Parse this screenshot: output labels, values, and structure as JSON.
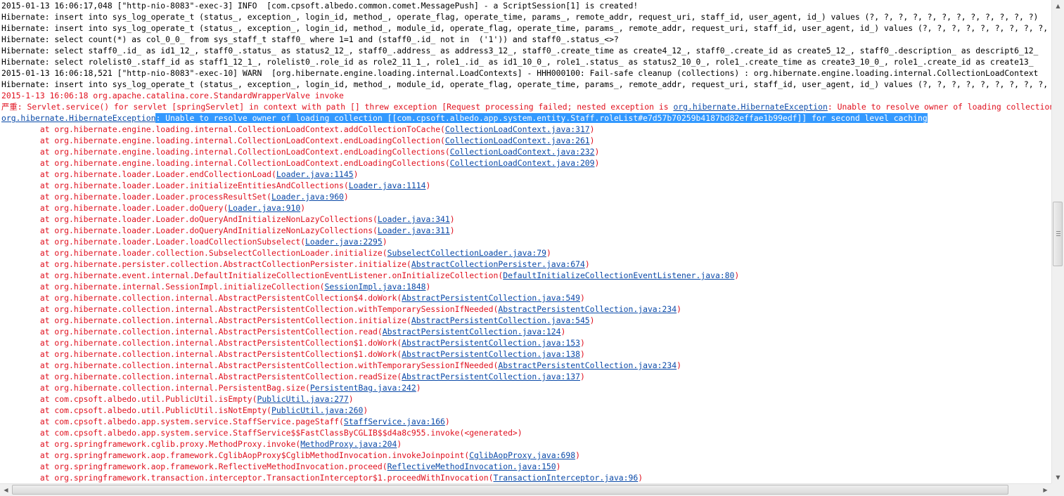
{
  "console": {
    "lines": [
      {
        "kind": "info",
        "parts": [
          {
            "t": "2015-01-13 16:06:17,048 [\"http-nio-8083\"-exec-3] INFO  [com.cpsoft.albedo.common.comet.MessagePush] - a ScriptSession[1] is created!"
          }
        ]
      },
      {
        "kind": "info",
        "parts": [
          {
            "t": "Hibernate: insert into sys_log_operate_t (status_, exception_, login_id, method_, operate_flag, operate_time, params_, remote_addr, request_uri, staff_id, user_agent, id_) values (?, ?, ?, ?, ?, ?, ?, ?, ?, ?, ?, ?)"
          }
        ]
      },
      {
        "kind": "info",
        "parts": [
          {
            "t": "Hibernate: insert into sys_log_operate_t (status_, exception_, login_id, method_, module_id, operate_flag, operate_time, params_, remote_addr, request_uri, staff_id, user_agent, id_) values (?, ?, ?, ?, ?, ?, ?, ?, ?, ?, ?, ?, ?)"
          }
        ]
      },
      {
        "kind": "info",
        "parts": [
          {
            "t": "Hibernate: select count(*) as col_0_0_ from sys_staff_t staff0_ where 1=1 and (staff0_.id_ not in  ('1')) and staff0_.status_<>?"
          }
        ]
      },
      {
        "kind": "info",
        "parts": [
          {
            "t": "Hibernate: select staff0_.id_ as id1_12_, staff0_.status_ as status2_12_, staff0_.address_ as address3_12_, staff0_.create_time as create4_12_, staff0_.create_id as create5_12_, staff0_.description_ as descript6_12_"
          }
        ]
      },
      {
        "kind": "info",
        "parts": [
          {
            "t": "Hibernate: select rolelist0_.staff_id as staff1_12_1_, rolelist0_.role_id as role2_11_1_, role1_.id_ as id1_10_0_, role1_.status_ as status2_10_0_, role1_.create_time as create3_10_0_, role1_.create_id as create13_"
          }
        ]
      },
      {
        "kind": "info",
        "parts": [
          {
            "t": "2015-01-13 16:06:18,521 [\"http-nio-8083\"-exec-10] WARN  [org.hibernate.engine.loading.internal.LoadContexts] - HHH000100: Fail-safe cleanup (collections) : org.hibernate.engine.loading.internal.CollectionLoadContext"
          }
        ]
      },
      {
        "kind": "info",
        "parts": [
          {
            "t": "Hibernate: insert into sys_log_operate_t (status_, exception_, login_id, method_, module_id, operate_flag, operate_time, params_, remote_addr, request_uri, staff_id, user_agent, id_) values (?, ?, ?, ?, ?, ?, ?, ?, ?, ?, ?, ?, ?)"
          }
        ]
      },
      {
        "kind": "err",
        "parts": [
          {
            "t": "2015-1-13 16:06:18 org.apache.catalina.core.StandardWrapperValve invoke"
          }
        ]
      },
      {
        "kind": "err",
        "parts": [
          {
            "t": "严重: Servlet.service() for servlet [springServlet] in context with path [] threw exception [Request processing failed; nested exception is "
          },
          {
            "t": "org.hibernate.HibernateException",
            "link": true
          },
          {
            "t": ": Unable to resolve owner of loading collection"
          }
        ]
      },
      {
        "kind": "err",
        "parts": [
          {
            "t": "org.hibernate.HibernateException",
            "link": true
          },
          {
            "t": ": Unable to resolve owner of loading collection [[com.cpsoft.albedo.app.system.entity.Staff.roleList#e7d57b70259b4187bd82effae1b99edf]] for second level caching",
            "sel": true
          }
        ]
      },
      {
        "kind": "trace",
        "parts": [
          {
            "t": "\tat org.hibernate.engine.loading.internal.CollectionLoadContext.addCollectionToCache("
          },
          {
            "t": "CollectionLoadContext.java:317",
            "link": true
          },
          {
            "t": ")"
          }
        ]
      },
      {
        "kind": "trace",
        "parts": [
          {
            "t": "\tat org.hibernate.engine.loading.internal.CollectionLoadContext.endLoadingCollection("
          },
          {
            "t": "CollectionLoadContext.java:261",
            "link": true
          },
          {
            "t": ")"
          }
        ]
      },
      {
        "kind": "trace",
        "parts": [
          {
            "t": "\tat org.hibernate.engine.loading.internal.CollectionLoadContext.endLoadingCollections("
          },
          {
            "t": "CollectionLoadContext.java:232",
            "link": true
          },
          {
            "t": ")"
          }
        ]
      },
      {
        "kind": "trace",
        "parts": [
          {
            "t": "\tat org.hibernate.engine.loading.internal.CollectionLoadContext.endLoadingCollections("
          },
          {
            "t": "CollectionLoadContext.java:209",
            "link": true
          },
          {
            "t": ")"
          }
        ]
      },
      {
        "kind": "trace",
        "parts": [
          {
            "t": "\tat org.hibernate.loader.Loader.endCollectionLoad("
          },
          {
            "t": "Loader.java:1145",
            "link": true
          },
          {
            "t": ")"
          }
        ]
      },
      {
        "kind": "trace",
        "parts": [
          {
            "t": "\tat org.hibernate.loader.Loader.initializeEntitiesAndCollections("
          },
          {
            "t": "Loader.java:1114",
            "link": true
          },
          {
            "t": ")"
          }
        ]
      },
      {
        "kind": "trace",
        "parts": [
          {
            "t": "\tat org.hibernate.loader.Loader.processResultSet("
          },
          {
            "t": "Loader.java:960",
            "link": true
          },
          {
            "t": ")"
          }
        ]
      },
      {
        "kind": "trace",
        "parts": [
          {
            "t": "\tat org.hibernate.loader.Loader.doQuery("
          },
          {
            "t": "Loader.java:910",
            "link": true
          },
          {
            "t": ")"
          }
        ]
      },
      {
        "kind": "trace",
        "parts": [
          {
            "t": "\tat org.hibernate.loader.Loader.doQueryAndInitializeNonLazyCollections("
          },
          {
            "t": "Loader.java:341",
            "link": true
          },
          {
            "t": ")"
          }
        ]
      },
      {
        "kind": "trace",
        "parts": [
          {
            "t": "\tat org.hibernate.loader.Loader.doQueryAndInitializeNonLazyCollections("
          },
          {
            "t": "Loader.java:311",
            "link": true
          },
          {
            "t": ")"
          }
        ]
      },
      {
        "kind": "trace",
        "parts": [
          {
            "t": "\tat org.hibernate.loader.Loader.loadCollectionSubselect("
          },
          {
            "t": "Loader.java:2295",
            "link": true
          },
          {
            "t": ")"
          }
        ]
      },
      {
        "kind": "trace",
        "parts": [
          {
            "t": "\tat org.hibernate.loader.collection.SubselectCollectionLoader.initialize("
          },
          {
            "t": "SubselectCollectionLoader.java:79",
            "link": true
          },
          {
            "t": ")"
          }
        ]
      },
      {
        "kind": "trace",
        "parts": [
          {
            "t": "\tat org.hibernate.persister.collection.AbstractCollectionPersister.initialize("
          },
          {
            "t": "AbstractCollectionPersister.java:674",
            "link": true
          },
          {
            "t": ")"
          }
        ]
      },
      {
        "kind": "trace",
        "parts": [
          {
            "t": "\tat org.hibernate.event.internal.DefaultInitializeCollectionEventListener.onInitializeCollection("
          },
          {
            "t": "DefaultInitializeCollectionEventListener.java:80",
            "link": true
          },
          {
            "t": ")"
          }
        ]
      },
      {
        "kind": "trace",
        "parts": [
          {
            "t": "\tat org.hibernate.internal.SessionImpl.initializeCollection("
          },
          {
            "t": "SessionImpl.java:1848",
            "link": true
          },
          {
            "t": ")"
          }
        ]
      },
      {
        "kind": "trace",
        "parts": [
          {
            "t": "\tat org.hibernate.collection.internal.AbstractPersistentCollection$4.doWork("
          },
          {
            "t": "AbstractPersistentCollection.java:549",
            "link": true
          },
          {
            "t": ")"
          }
        ]
      },
      {
        "kind": "trace",
        "parts": [
          {
            "t": "\tat org.hibernate.collection.internal.AbstractPersistentCollection.withTemporarySessionIfNeeded("
          },
          {
            "t": "AbstractPersistentCollection.java:234",
            "link": true
          },
          {
            "t": ")"
          }
        ]
      },
      {
        "kind": "trace",
        "parts": [
          {
            "t": "\tat org.hibernate.collection.internal.AbstractPersistentCollection.initialize("
          },
          {
            "t": "AbstractPersistentCollection.java:545",
            "link": true
          },
          {
            "t": ")"
          }
        ]
      },
      {
        "kind": "trace",
        "parts": [
          {
            "t": "\tat org.hibernate.collection.internal.AbstractPersistentCollection.read("
          },
          {
            "t": "AbstractPersistentCollection.java:124",
            "link": true
          },
          {
            "t": ")"
          }
        ]
      },
      {
        "kind": "trace",
        "parts": [
          {
            "t": "\tat org.hibernate.collection.internal.AbstractPersistentCollection$1.doWork("
          },
          {
            "t": "AbstractPersistentCollection.java:153",
            "link": true
          },
          {
            "t": ")"
          }
        ]
      },
      {
        "kind": "trace",
        "parts": [
          {
            "t": "\tat org.hibernate.collection.internal.AbstractPersistentCollection$1.doWork("
          },
          {
            "t": "AbstractPersistentCollection.java:138",
            "link": true
          },
          {
            "t": ")"
          }
        ]
      },
      {
        "kind": "trace",
        "parts": [
          {
            "t": "\tat org.hibernate.collection.internal.AbstractPersistentCollection.withTemporarySessionIfNeeded("
          },
          {
            "t": "AbstractPersistentCollection.java:234",
            "link": true
          },
          {
            "t": ")"
          }
        ]
      },
      {
        "kind": "trace",
        "parts": [
          {
            "t": "\tat org.hibernate.collection.internal.AbstractPersistentCollection.readSize("
          },
          {
            "t": "AbstractPersistentCollection.java:137",
            "link": true
          },
          {
            "t": ")"
          }
        ]
      },
      {
        "kind": "trace",
        "parts": [
          {
            "t": "\tat org.hibernate.collection.internal.PersistentBag.size("
          },
          {
            "t": "PersistentBag.java:242",
            "link": true
          },
          {
            "t": ")"
          }
        ]
      },
      {
        "kind": "trace",
        "parts": [
          {
            "t": "\tat com.cpsoft.albedo.util.PublicUtil.isEmpty("
          },
          {
            "t": "PublicUtil.java:277",
            "link": true
          },
          {
            "t": ")"
          }
        ]
      },
      {
        "kind": "trace",
        "parts": [
          {
            "t": "\tat com.cpsoft.albedo.util.PublicUtil.isNotEmpty("
          },
          {
            "t": "PublicUtil.java:260",
            "link": true
          },
          {
            "t": ")"
          }
        ]
      },
      {
        "kind": "trace",
        "parts": [
          {
            "t": "\tat com.cpsoft.albedo.app.system.service.StaffService.pageStaff("
          },
          {
            "t": "StaffService.java:166",
            "link": true
          },
          {
            "t": ")"
          }
        ]
      },
      {
        "kind": "trace",
        "parts": [
          {
            "t": "\tat com.cpsoft.albedo.app.system.service.StaffService$$FastClassByCGLIB$$d4a8c955.invoke(<generated>)"
          }
        ]
      },
      {
        "kind": "trace",
        "parts": [
          {
            "t": "\tat org.springframework.cglib.proxy.MethodProxy.invoke("
          },
          {
            "t": "MethodProxy.java:204",
            "link": true
          },
          {
            "t": ")"
          }
        ]
      },
      {
        "kind": "trace",
        "parts": [
          {
            "t": "\tat org.springframework.aop.framework.CglibAopProxy$CglibMethodInvocation.invokeJoinpoint("
          },
          {
            "t": "CglibAopProxy.java:698",
            "link": true
          },
          {
            "t": ")"
          }
        ]
      },
      {
        "kind": "trace",
        "parts": [
          {
            "t": "\tat org.springframework.aop.framework.ReflectiveMethodInvocation.proceed("
          },
          {
            "t": "ReflectiveMethodInvocation.java:150",
            "link": true
          },
          {
            "t": ")"
          }
        ]
      },
      {
        "kind": "trace",
        "parts": [
          {
            "t": "\tat org.springframework.transaction.interceptor.TransactionInterceptor$1.proceedWithInvocation("
          },
          {
            "t": "TransactionInterceptor.java:96",
            "link": true
          },
          {
            "t": ")"
          }
        ]
      }
    ]
  },
  "scrollbars": {
    "vertical": {
      "position": 0.48,
      "visible_fraction": 0.14,
      "up_icon": "arrow-up-icon",
      "down_icon": "arrow-down-icon"
    },
    "horizontal": {
      "position": 0.0,
      "visible_fraction": 0.97,
      "left_icon": "arrow-left-icon",
      "right_icon": "arrow-right-icon"
    }
  },
  "colors": {
    "info_text": "#000000",
    "error_text": "#e0101e",
    "link_text": "#0b4aa8",
    "selection_bg": "#3399ff",
    "selection_text": "#ffffff"
  }
}
